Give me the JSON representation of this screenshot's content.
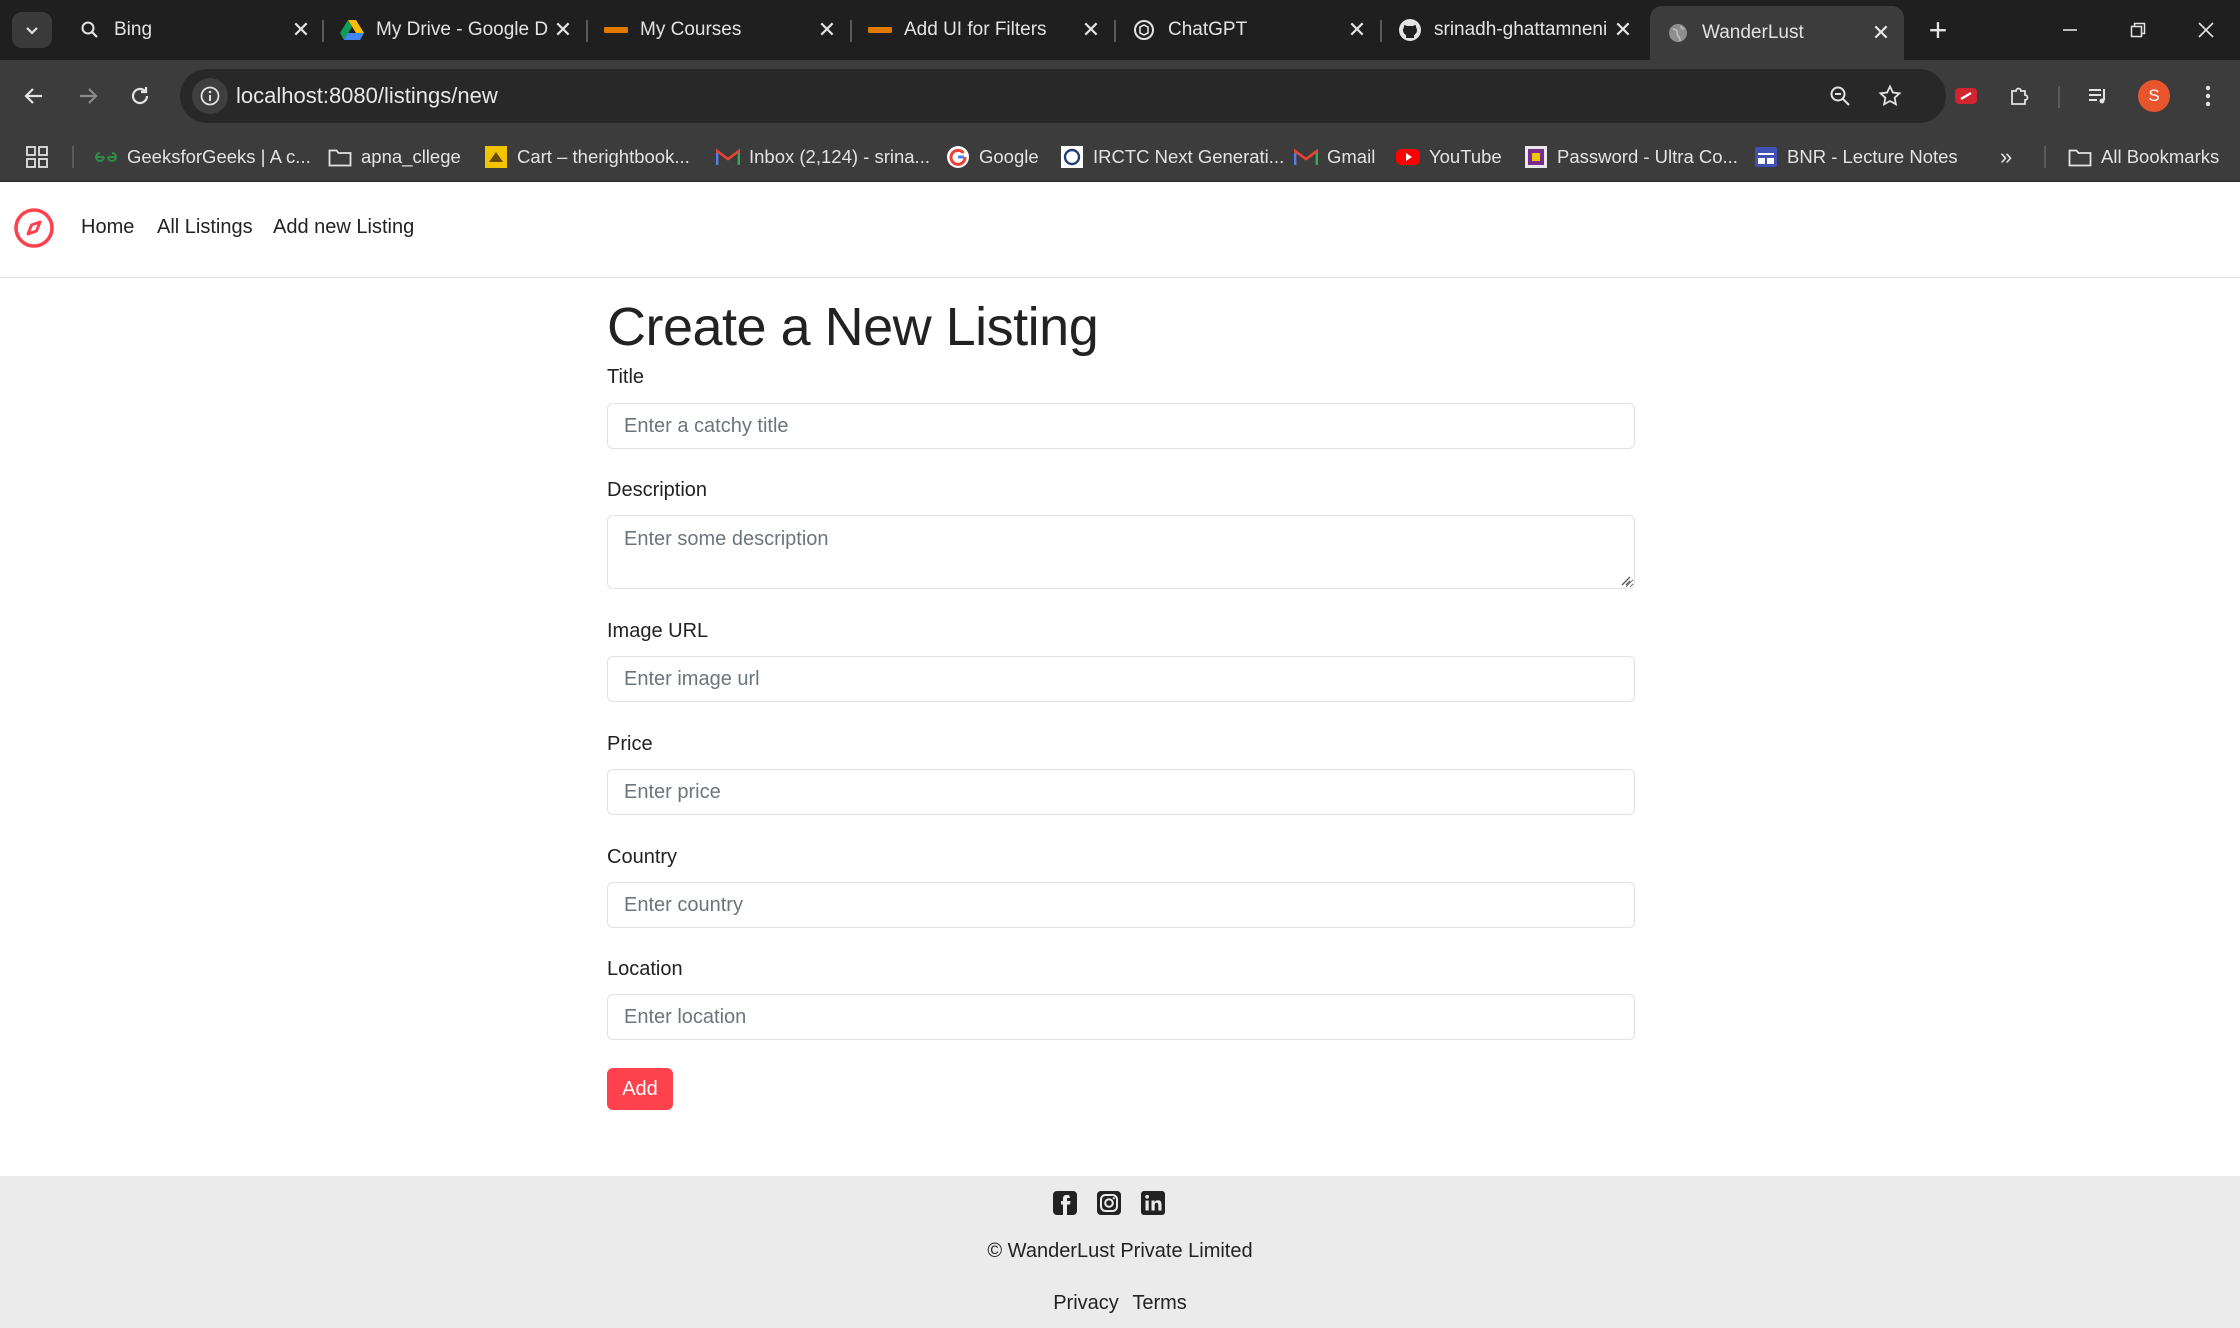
{
  "browser": {
    "tabs": [
      {
        "title": "Bing",
        "icon": "bing-search-icon"
      },
      {
        "title": "My Drive - Google Drive",
        "icon": "google-drive-icon"
      },
      {
        "title": "My Courses",
        "icon": "college-icon"
      },
      {
        "title": "Add UI for Filters",
        "icon": "college-icon"
      },
      {
        "title": "ChatGPT",
        "icon": "chatgpt-icon"
      },
      {
        "title": "srinadh-ghattamneni",
        "icon": "github-icon"
      },
      {
        "title": "WanderLust",
        "icon": "globe-icon"
      }
    ],
    "url": "localhost:8080/listings/new",
    "profile_initial": "S",
    "bookmarks": [
      {
        "label": "GeeksforGeeks | A c...",
        "icon": "gfg-icon"
      },
      {
        "label": "apna_cllege",
        "icon": "folder-icon"
      },
      {
        "label": "Cart – therightbook...",
        "icon": "book-icon"
      },
      {
        "label": "Inbox (2,124) - srina...",
        "icon": "gmail-icon"
      },
      {
        "label": "Google",
        "icon": "google-icon"
      },
      {
        "label": "IRCTC Next Generati...",
        "icon": "irctc-icon"
      },
      {
        "label": "Gmail",
        "icon": "gmail-icon"
      },
      {
        "label": "YouTube",
        "icon": "youtube-icon"
      },
      {
        "label": "Password - Ultra Co...",
        "icon": "password-icon"
      },
      {
        "label": "BNR - Lecture Notes",
        "icon": "notes-icon"
      }
    ],
    "all_bookmarks": "All Bookmarks"
  },
  "site": {
    "nav": [
      "Home",
      "All Listings",
      "Add new Listing"
    ],
    "brand_color": "#fe424d"
  },
  "form": {
    "heading": "Create a New Listing",
    "fields": [
      {
        "label": "Title",
        "placeholder": "Enter a catchy title"
      },
      {
        "label": "Description",
        "placeholder": "Enter some description"
      },
      {
        "label": "Image URL",
        "placeholder": "Enter image url"
      },
      {
        "label": "Price",
        "placeholder": "Enter price"
      },
      {
        "label": "Country",
        "placeholder": "Enter country"
      },
      {
        "label": "Location",
        "placeholder": "Enter location"
      }
    ],
    "submit_label": "Add"
  },
  "footer": {
    "copyright": "© WanderLust Private Limited",
    "links": [
      "Privacy",
      "Terms"
    ],
    "social": [
      "facebook-icon",
      "instagram-icon",
      "linkedin-icon"
    ]
  }
}
